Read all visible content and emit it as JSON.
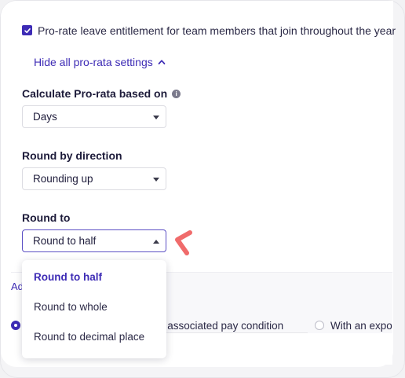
{
  "prorate": {
    "checkbox_label": "Pro-rate leave entitlement for team members that join throughout the year",
    "checked": true,
    "toggle_link": "Hide all pro-rata settings"
  },
  "calculate": {
    "label": "Calculate Pro-rata based on",
    "value": "Days"
  },
  "round_direction": {
    "label": "Round by direction",
    "value": "Rounding up"
  },
  "round_to": {
    "label": "Round to",
    "value": "Round to half",
    "options": [
      "Round to half",
      "Round to whole",
      "Round to decimal place"
    ],
    "selected_index": 0
  },
  "background": {
    "ad_text": "Ad",
    "pay_condition_text": "e associated pay condition",
    "export_text": "With an expor"
  },
  "colors": {
    "accent": "#3d2bb5",
    "pointer": "#f06b6b"
  }
}
